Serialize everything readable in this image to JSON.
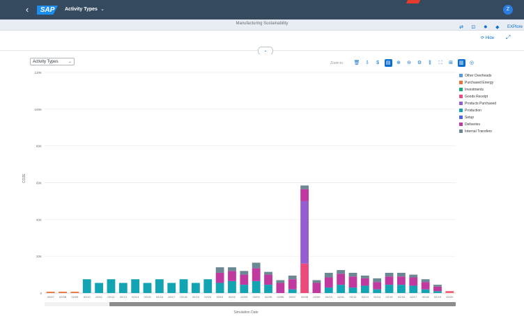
{
  "shell": {
    "back_icon": "back-arrow-icon",
    "logo_text": "SAP",
    "app_title": "Activity Types",
    "title_chevron": "⌄",
    "avatar_initial": "Z"
  },
  "subheader": {
    "title": "Manufacturing Sustainability",
    "actions": [
      {
        "name": "share-icon",
        "glyph": "⇄"
      },
      {
        "name": "edit-icon",
        "glyph": "⊡"
      },
      {
        "name": "settings-icon",
        "glyph": "✸"
      },
      {
        "name": "bookmark-icon",
        "glyph": "◆"
      }
    ],
    "explore_label": "EXPlore"
  },
  "page_bar": {
    "hide_label": "⟳ Hide",
    "expand_icon": "⤢"
  },
  "collapse_toggle": "⌄",
  "chart_toolbar": {
    "select_value": "Activity Types",
    "zoom_label": "Zoom in",
    "buttons": [
      {
        "name": "delete-icon",
        "glyph": "🗑",
        "active": false
      },
      {
        "name": "download-icon",
        "glyph": "⇩",
        "active": false
      },
      {
        "name": "dollar-icon",
        "glyph": "$",
        "active": false
      },
      {
        "name": "table-view-icon",
        "glyph": "▤",
        "active": true
      },
      {
        "name": "zoom-in-icon",
        "glyph": "⊕",
        "active": false
      },
      {
        "name": "zoom-out-icon",
        "glyph": "⊖",
        "active": false
      },
      {
        "name": "settings-icon",
        "glyph": "⚙",
        "active": false
      },
      {
        "name": "columns-icon",
        "glyph": "⫼",
        "active": false
      },
      {
        "name": "fullscreen-icon",
        "glyph": "⛶",
        "active": false
      },
      {
        "name": "personalize-icon",
        "glyph": "⊞",
        "active": false
      },
      {
        "name": "chart-view-icon",
        "glyph": "▥",
        "active": true
      },
      {
        "name": "settings-circle-icon",
        "glyph": "◎",
        "active": false
      }
    ]
  },
  "colors": {
    "shell_bg": "#354a5f",
    "accent": "#0a6ed1"
  },
  "chart_data": {
    "type": "bar",
    "stacked": true,
    "categories": [
      "02/07",
      "02/08",
      "02/09",
      "02/10",
      "02/11",
      "02/12",
      "02/13",
      "02/14",
      "02/15",
      "02/16",
      "02/17",
      "02/18",
      "02/19",
      "02/20",
      "02/01",
      "02/02",
      "02/03",
      "02/04",
      "02/05",
      "02/06",
      "02/07",
      "02/08",
      "02/09",
      "02/10",
      "02/11",
      "02/12",
      "02/13",
      "02/14",
      "02/15",
      "02/16",
      "02/17",
      "02/18",
      "02/19",
      "02/20"
    ],
    "series": [
      {
        "name": "Other Overheads",
        "color": "#5899da",
        "values": [
          0,
          0,
          0,
          0,
          0,
          0,
          0,
          0,
          0,
          0,
          0,
          0,
          0,
          0,
          0,
          0,
          0,
          0,
          0,
          0,
          0,
          0,
          0,
          0,
          0,
          0,
          0,
          0,
          0,
          0,
          0,
          0,
          0,
          0
        ]
      },
      {
        "name": "Purchased Energy",
        "color": "#e8743b",
        "values": [
          0.7,
          0.7,
          0.7,
          0,
          0,
          0,
          0,
          0,
          0,
          0,
          0,
          0,
          0,
          0,
          0,
          0,
          0,
          0,
          0,
          0,
          0,
          0,
          0,
          0,
          0,
          0,
          0,
          0,
          0,
          0,
          0,
          0,
          0,
          0.3
        ]
      },
      {
        "name": "Investments",
        "color": "#19a979",
        "values": [
          0,
          0,
          0,
          0,
          0,
          0,
          0,
          0,
          0,
          0,
          0,
          0,
          0,
          0,
          0,
          0,
          0,
          0,
          0,
          0,
          0,
          0,
          0,
          0,
          0,
          0,
          0,
          0,
          0,
          0,
          0,
          0,
          0,
          0
        ]
      },
      {
        "name": "Goods Receipt",
        "color": "#ed4a7b",
        "values": [
          0,
          0,
          0,
          0,
          0,
          0,
          0,
          0,
          0,
          0,
          0,
          0,
          0,
          0,
          0,
          0,
          0,
          0,
          0,
          0,
          0,
          16,
          0,
          0,
          0,
          0,
          0,
          0,
          0,
          0,
          0,
          0,
          0,
          0.7
        ]
      },
      {
        "name": "Products Purchased",
        "color": "#945ecf",
        "values": [
          0,
          0,
          0,
          0,
          0,
          0,
          0,
          0,
          0,
          0,
          0,
          0,
          0,
          0,
          0,
          0,
          0,
          0,
          0,
          0,
          0,
          34,
          0,
          0,
          0,
          0,
          0,
          0,
          0,
          0,
          0,
          0,
          0,
          0
        ]
      },
      {
        "name": "Production",
        "color": "#13a4b4",
        "values": [
          0,
          0,
          0,
          7.5,
          5.5,
          7.5,
          5.5,
          7.5,
          5.5,
          7.5,
          5.5,
          7.5,
          5.5,
          7.5,
          5.5,
          6.5,
          4.5,
          6.5,
          4.5,
          0,
          2,
          0,
          0,
          3,
          4.5,
          3,
          4,
          2,
          4.5,
          4.5,
          4,
          2,
          1,
          0
        ]
      },
      {
        "name": "Setup",
        "color": "#525df4",
        "values": [
          0,
          0,
          0,
          0,
          0,
          0,
          0,
          0,
          0,
          0,
          0,
          0,
          0,
          0,
          0,
          0,
          0,
          0,
          0,
          0,
          0,
          0,
          0,
          0,
          0,
          0,
          0,
          0,
          0,
          0,
          0,
          0,
          0,
          0
        ]
      },
      {
        "name": "Deliveries",
        "color": "#bf399e",
        "values": [
          0,
          0,
          0,
          0,
          0,
          0,
          0,
          0,
          0,
          0,
          0,
          0,
          0,
          0,
          5.5,
          5.5,
          5.5,
          7,
          5.5,
          5.5,
          5.5,
          6.5,
          5.5,
          5.5,
          6,
          6,
          4,
          4,
          4.5,
          4.5,
          4.5,
          4,
          2.5,
          0
        ]
      },
      {
        "name": "Internal Transfers",
        "color": "#6c8893",
        "values": [
          0,
          0,
          0,
          0,
          0,
          0,
          0,
          0,
          0,
          0,
          0,
          0,
          0,
          0,
          3,
          2,
          2,
          3,
          1.5,
          1.5,
          2,
          2,
          1.5,
          2.5,
          2,
          2,
          1.5,
          2,
          2,
          2,
          1.5,
          1.5,
          1,
          0
        ]
      }
    ],
    "xlabel": "Simulation Date",
    "ylabel": "CO2E",
    "yticks": [
      "0",
      "20K",
      "40K",
      "60K",
      "80K",
      "100K",
      "120K"
    ],
    "ylim": [
      0,
      120
    ],
    "grid": true,
    "legend_position": "right"
  }
}
